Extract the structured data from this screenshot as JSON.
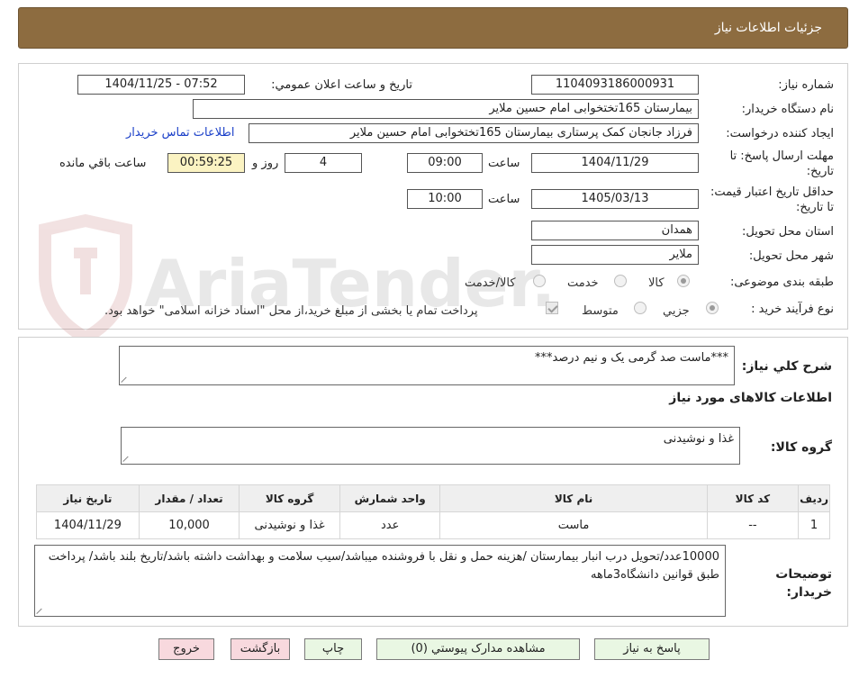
{
  "header": {
    "title": "جزئیات اطلاعات نیاز"
  },
  "watermark": {
    "text": "AriaTender.net"
  },
  "form": {
    "need_number_label": "شماره نیاز:",
    "need_number": "1104093186000931",
    "announce_label": "تاریخ و ساعت اعلان عمومي:",
    "announce_value": "1404/11/25 - 07:52",
    "buyer_org_label": "نام دستگاه خریدار:",
    "buyer_org": "بیمارستان 165تختخوابی امام حسین ملایر",
    "creator_label": "ایجاد کننده درخواست:",
    "creator": "فرزاد جانجان کمک پرستاری بیمارستان 165تختخوابی امام حسین ملایر",
    "contact_link": "اطلاعات تماس خریدار",
    "deadline_label": "مهلت ارسال پاسخ: تا تاریخ:",
    "deadline_date": "1404/11/29",
    "time_label": "ساعت",
    "deadline_time": "09:00",
    "days_value": "4",
    "days_label": "روز و",
    "remaining_time": "00:59:25",
    "remaining_label": "ساعت باقي مانده",
    "validity_label": "حداقل تاریخ اعتبار قیمت: تا تاریخ:",
    "validity_date": "1405/03/13",
    "validity_time": "10:00",
    "province_label": "استان محل تحویل:",
    "province": "همدان",
    "city_label": "شهر محل تحویل:",
    "city": "ملایر",
    "category_label": "طبقه بندی موضوعی:",
    "category_options": [
      "کالا",
      "خدمت",
      "کالا/خدمت"
    ],
    "process_label": "نوع فرآیند خرید :",
    "process_options": [
      "جزیي",
      "متوسط"
    ],
    "payment_note": "پرداخت تمام یا بخشی از مبلغ خرید،از محل \"اسناد خزانه اسلامی\" خواهد بود."
  },
  "summary": {
    "desc_label": "شرح کلي نیاز:",
    "desc_value": "***ماست صد گرمی یک و نیم درصد***",
    "goods_title": "اطلاعات کالاهای مورد نیاز",
    "group_label": "گروه کالا:",
    "group_value": "غذا و نوشیدنی",
    "table": {
      "headers": [
        "ردیف",
        "کد کالا",
        "نام کالا",
        "واحد شمارش",
        "گروه کالا",
        "تعداد / مقدار",
        "تاریخ نیاز"
      ],
      "rows": [
        [
          "1",
          "--",
          "ماست",
          "عدد",
          "غذا و نوشیدنی",
          "10,000",
          "1404/11/29"
        ]
      ]
    },
    "buyer_notes_label": "توضیحات خریدار:",
    "buyer_notes": "10000عدد/تحویل درب انبار بیمارستان /هزینه حمل و نقل با فروشنده میباشد/سیب سلامت و بهداشت داشته باشد/تاریخ بلند باشد/ پرداخت طبق قوانین دانشگاه3ماهه"
  },
  "buttons": {
    "reply": "پاسخ به نیاز",
    "view_docs": "مشاهده مدارک پیوستي (0)",
    "print": "چاپ",
    "back": "بازگشت",
    "exit": "خروج"
  },
  "colors": {
    "header_bg": "#8d6c40",
    "button_green": "#e9f7e3",
    "button_pink": "#f8d9de",
    "remaining_bg": "#fbf3c2",
    "link": "#1a3fc8"
  }
}
